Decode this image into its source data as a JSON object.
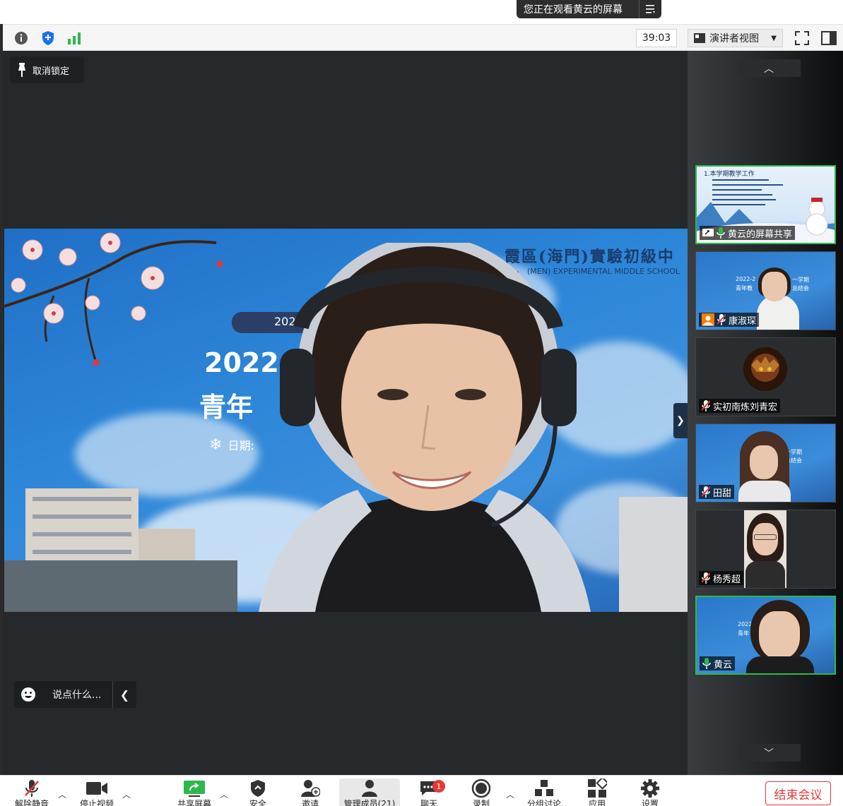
{
  "banner": {
    "text": "您正在观看黄云的屏幕",
    "menu_icon": "list-menu-icon"
  },
  "toolbar": {
    "timer": "39:03",
    "view_mode": "演讲者视图",
    "icons": [
      "info-icon",
      "shield-icon",
      "signal-icon",
      "fullscreen-icon",
      "sidebar-icon"
    ]
  },
  "main": {
    "unlock_label": "取消锁定",
    "chat_placeholder": "说点什么...",
    "slide": {
      "school_cn": "霞區(海門)實驗初級中學",
      "school_en": "(MEN) EXPERIMENTAL MIDDLE SCHOOL",
      "pill": "2022-2",
      "year": "2022",
      "title": "青年",
      "date": "日期:"
    }
  },
  "gallery": {
    "tiles": [
      {
        "label": "黄云的屏幕共享",
        "type": "screen",
        "slide_heading": "1.本学期教学工作",
        "active": true
      },
      {
        "label": "康淑琛",
        "type": "video",
        "active": false,
        "slide_text_a": "2022-2",
        "slide_text_b": "一学期",
        "slide_text_c": "青年教",
        "slide_text_d": "总结会"
      },
      {
        "label": "实初南炼刘青宏",
        "type": "avatar",
        "active": false
      },
      {
        "label": "田甜",
        "type": "video",
        "active": false,
        "slide_text_a": "第一学期",
        "slide_text_b": "年总结会"
      },
      {
        "label": "杨秀超",
        "type": "video",
        "active": false
      },
      {
        "label": "黄云",
        "type": "video",
        "active": true,
        "slide_text_a": "2022",
        "slide_text_b": "青年"
      }
    ]
  },
  "bottom": {
    "items": [
      {
        "label": "解除静音",
        "icon": "microphone-muted-icon"
      },
      {
        "label": "停止视频",
        "icon": "video-camera-icon"
      },
      {
        "label": "共享屏幕",
        "icon": "share-screen-icon"
      },
      {
        "label": "安全",
        "icon": "security-shield-icon"
      },
      {
        "label": "邀请",
        "icon": "invite-person-icon"
      },
      {
        "label": "管理成员(21)",
        "icon": "participants-icon"
      },
      {
        "label": "聊天",
        "icon": "chat-icon",
        "badge": "1"
      },
      {
        "label": "录制",
        "icon": "record-icon"
      },
      {
        "label": "分组讨论",
        "icon": "breakout-rooms-icon"
      },
      {
        "label": "应用",
        "icon": "apps-icon"
      },
      {
        "label": "设置",
        "icon": "settings-gear-icon"
      }
    ],
    "end_label": "结束会议"
  },
  "colors": {
    "accent_green": "#2db84d",
    "end_red": "#e53935",
    "dark_bg": "#25292c"
  }
}
